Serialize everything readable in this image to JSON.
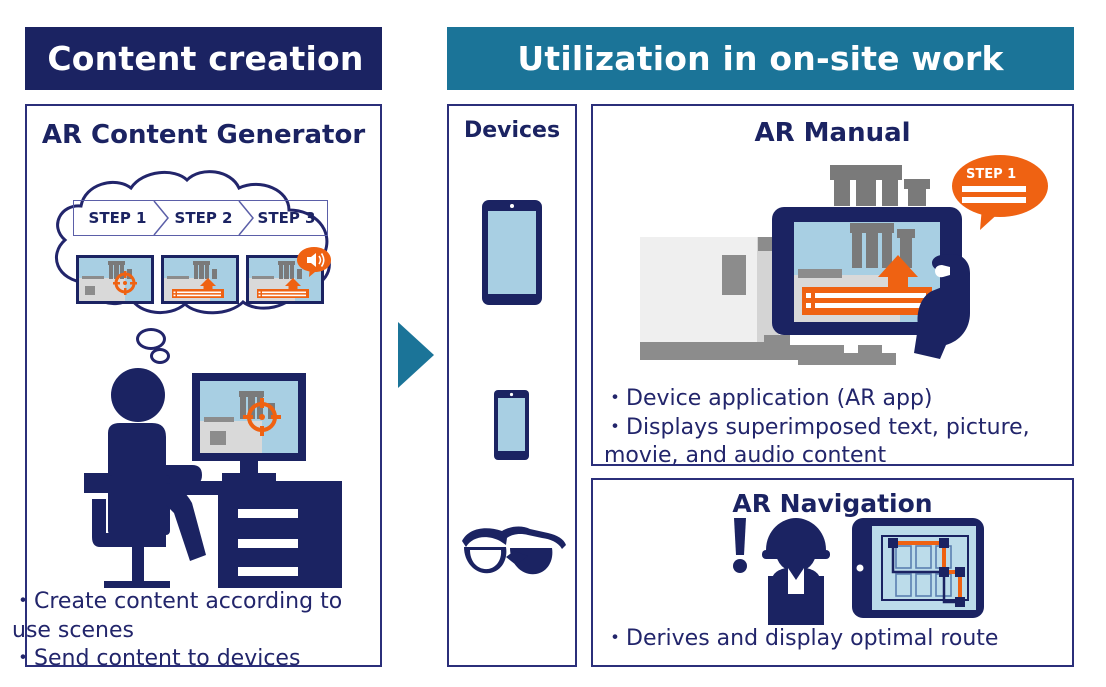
{
  "headers": {
    "left": "Content creation",
    "right": "Utilization in on-site work"
  },
  "panels": {
    "generator": {
      "title": "AR Content Generator",
      "steps": [
        {
          "label": "STEP 1"
        },
        {
          "label": "STEP 2"
        },
        {
          "label": "STEP 3"
        }
      ],
      "bullets": [
        "・Create content according to use scenes",
        "・Send content to devices"
      ]
    },
    "devices": {
      "title": "Devices",
      "items": [
        {
          "name": "tablet"
        },
        {
          "name": "smartphone"
        },
        {
          "name": "smart-glasses"
        }
      ]
    },
    "ar_manual": {
      "title": "AR Manual",
      "callout_label": "STEP 1",
      "bullets": [
        "・Device application (AR app)",
        "・Displays superimposed text, picture, movie, and audio content"
      ]
    },
    "ar_navigation": {
      "title": "AR Navigation",
      "bullets": [
        "・Derives and display optimal route"
      ]
    }
  },
  "flow": {
    "arrow_direction": "right"
  },
  "colors": {
    "navy": "#1b2362",
    "navy_text": "#22256b",
    "teal": "#1b7498",
    "orange": "#ef6212",
    "light_blue": "#a8cfe3",
    "gray": "#808080",
    "light_gray": "#efefef",
    "border": "#2b2f7a"
  }
}
